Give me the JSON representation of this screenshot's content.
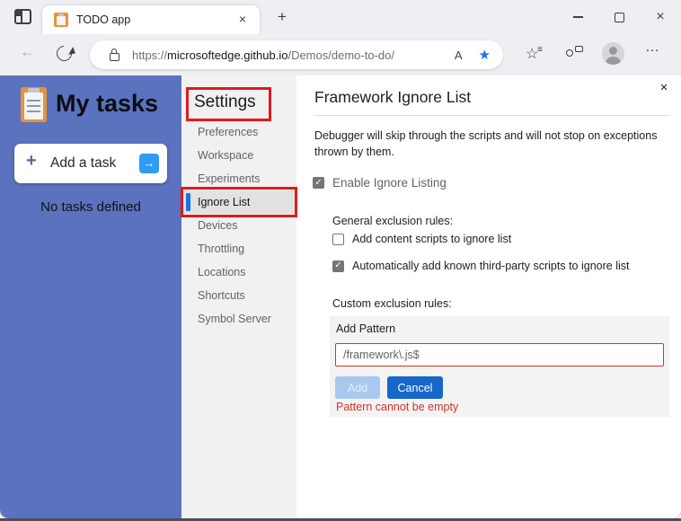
{
  "browser": {
    "tab_title": "TODO app",
    "url": {
      "protocol": "https://",
      "host": "microsoftedge.github.io",
      "path": "/Demos/demo-to-do/"
    }
  },
  "glyphs": {
    "close": "×",
    "new_tab": "+",
    "back": "←",
    "more": "…",
    "star": "★",
    "star_outline": "☆",
    "lines": "≡",
    "read_aloud": "A",
    "plus": "+",
    "arrow_right": "→",
    "check": "✓"
  },
  "todo": {
    "title": "My tasks",
    "add_task_label": "Add a task",
    "empty_message": "No tasks defined"
  },
  "settings": {
    "heading": "Settings",
    "items": [
      {
        "label": "Preferences",
        "selected": false
      },
      {
        "label": "Workspace",
        "selected": false
      },
      {
        "label": "Experiments",
        "selected": false
      },
      {
        "label": "Ignore List",
        "selected": true
      },
      {
        "label": "Devices",
        "selected": false
      },
      {
        "label": "Throttling",
        "selected": false
      },
      {
        "label": "Locations",
        "selected": false
      },
      {
        "label": "Shortcuts",
        "selected": false
      },
      {
        "label": "Symbol Server",
        "selected": false
      }
    ]
  },
  "panel": {
    "title": "Framework Ignore List",
    "description": "Debugger will skip through the scripts and will not stop on exceptions thrown by them.",
    "enable_label": "Enable Ignore Listing",
    "general_rules_label": "General exclusion rules:",
    "content_scripts_label": "Add content scripts to ignore list",
    "third_party_label": "Automatically add known third-party scripts to ignore list",
    "custom_rules_label": "Custom exclusion rules:",
    "add_pattern_label": "Add Pattern",
    "pattern_value": "/framework\\.js$",
    "add_label": "Add",
    "cancel_label": "Cancel",
    "error_message": "Pattern cannot be empty"
  },
  "annotations": {
    "highlighted": [
      "Settings",
      "Ignore List"
    ],
    "color": "#e2191c"
  },
  "colors": {
    "sidebar": "#5b72be",
    "selection_bar": "#1a73e8",
    "cancel_button": "#1567c9",
    "error": "#d13328",
    "favorite_star": "#1a73e8"
  }
}
